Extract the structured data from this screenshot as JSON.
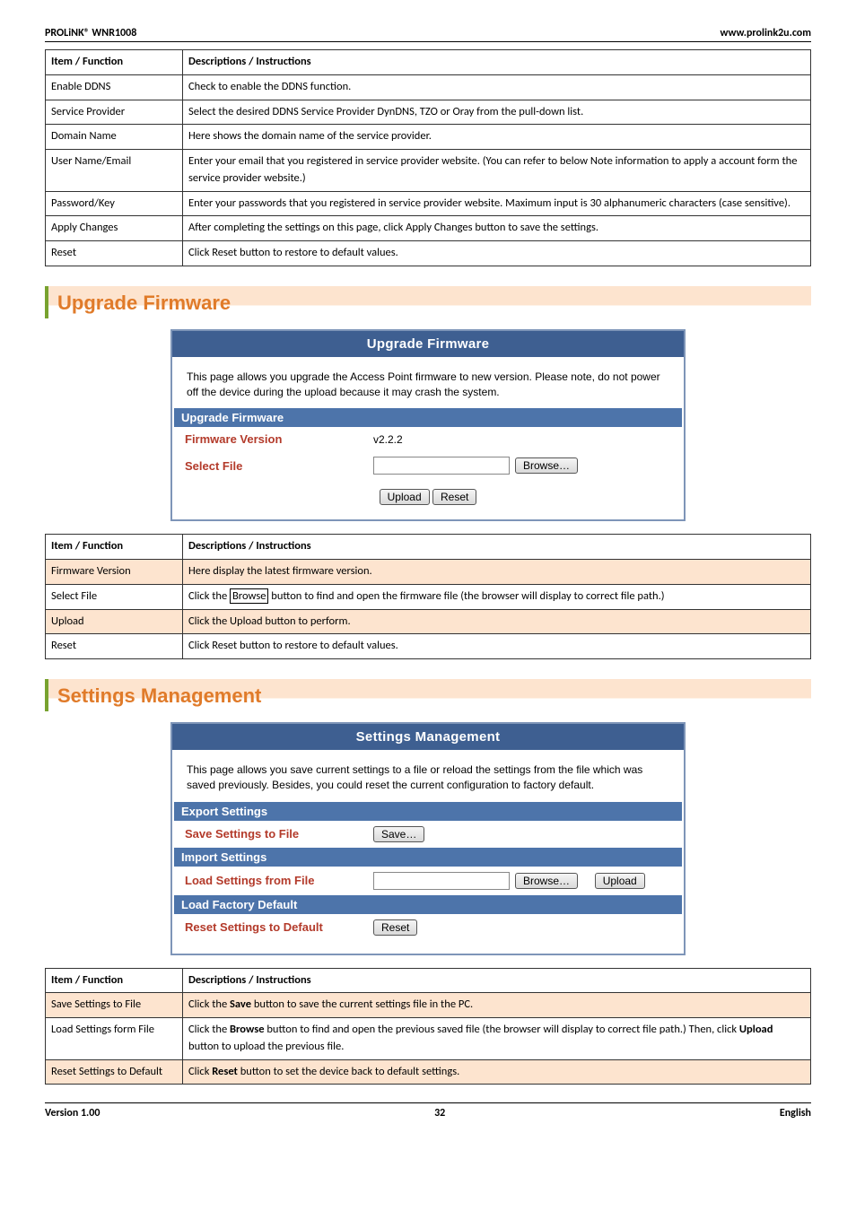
{
  "header": {
    "left": "PROLiNK® WNR1008",
    "right": "www.prolink2u.com"
  },
  "footer": {
    "left": "Version 1.00",
    "center": "32",
    "right": "English"
  },
  "table1": {
    "h1": "Item / Function",
    "h2": "Descriptions / Instructions",
    "rows": [
      {
        "a": "Enable DDNS",
        "b": "Check to enable the DDNS function."
      },
      {
        "a": "Service Provider",
        "b": "Select the desired DDNS Service Provider DynDNS, TZO or Oray from the pull-down list."
      },
      {
        "a": "Domain Name",
        "b": "Here shows the domain name of the service provider."
      },
      {
        "a": "User Name/Email",
        "b": "Enter your email that you registered in service provider website. (You can refer to below Note information to apply a account form the service provider website.)"
      },
      {
        "a": "Password/Key",
        "b": "Enter your passwords that you registered in service provider website. Maximum input is 30 alphanumeric characters (case sensitive)."
      },
      {
        "a": "Apply Changes",
        "b": "After completing the settings on this page, click Apply Changes button to save the settings."
      },
      {
        "a": "Reset",
        "b": "Click Reset button to restore to default values."
      }
    ]
  },
  "heading1": "Upgrade Firmware",
  "panel1": {
    "title": "Upgrade Firmware",
    "intro": "This page allows you upgrade the Access Point firmware to new version. Please note, do not power off the device during the upload because it may crash the system.",
    "subhead": "Upgrade Firmware",
    "row1_label": "Firmware Version",
    "row1_value": "v2.2.2",
    "row2_label": "Select File",
    "browse_btn": "Browse…",
    "upload_btn": "Upload",
    "reset_btn": "Reset"
  },
  "table2": {
    "h1": "Item / Function",
    "h2": "Descriptions / Instructions",
    "rows": [
      {
        "a": "Firmware Version",
        "b": "Here display the latest firmware version.",
        "z": true
      },
      {
        "a": "Select File",
        "b_pre": "Click the ",
        "b_boxed": "Browse",
        "b_post": " button to find and open the firmware file (the browser will display to correct file path.)"
      },
      {
        "a": "Upload",
        "b": "Click the Upload button to perform.",
        "z": true
      },
      {
        "a": "Reset",
        "b": "Click Reset button to restore to default values."
      }
    ]
  },
  "heading2": "Settings Management",
  "panel2": {
    "title": "Settings Management",
    "intro": "This page allows you save current settings to a file or reload the settings from the file which was saved previously. Besides, you could reset the current configuration to factory default.",
    "sub1": "Export Settings",
    "r1_label": "Save Settings to File",
    "save_btn": "Save…",
    "sub2": "Import Settings",
    "r2_label": "Load Settings from File",
    "browse_btn": "Browse…",
    "upload_btn": "Upload",
    "sub3": "Load Factory Default",
    "r3_label": "Reset Settings to Default",
    "reset_btn": "Reset"
  },
  "table3": {
    "h1": "Item / Function",
    "h2": "Descriptions / Instructions",
    "r1a": "Save Settings to File",
    "r1b_pre": "Click the ",
    "r1b_bold": "Save",
    "r1b_post": " button to save the current settings file in the PC.",
    "r2a": "Load Settings form File",
    "r2b_pre": "Click the ",
    "r2b_bold1": "Browse",
    "r2b_mid": " button to find and open the previous saved file (the browser will display to correct file path.) Then, click ",
    "r2b_bold2": "Upload",
    "r2b_post": " button to upload the previous file.",
    "r3a": "Reset Settings to Default",
    "r3b_pre": "Click ",
    "r3b_bold": "Reset",
    "r3b_post": " button to set the device back to default settings."
  }
}
